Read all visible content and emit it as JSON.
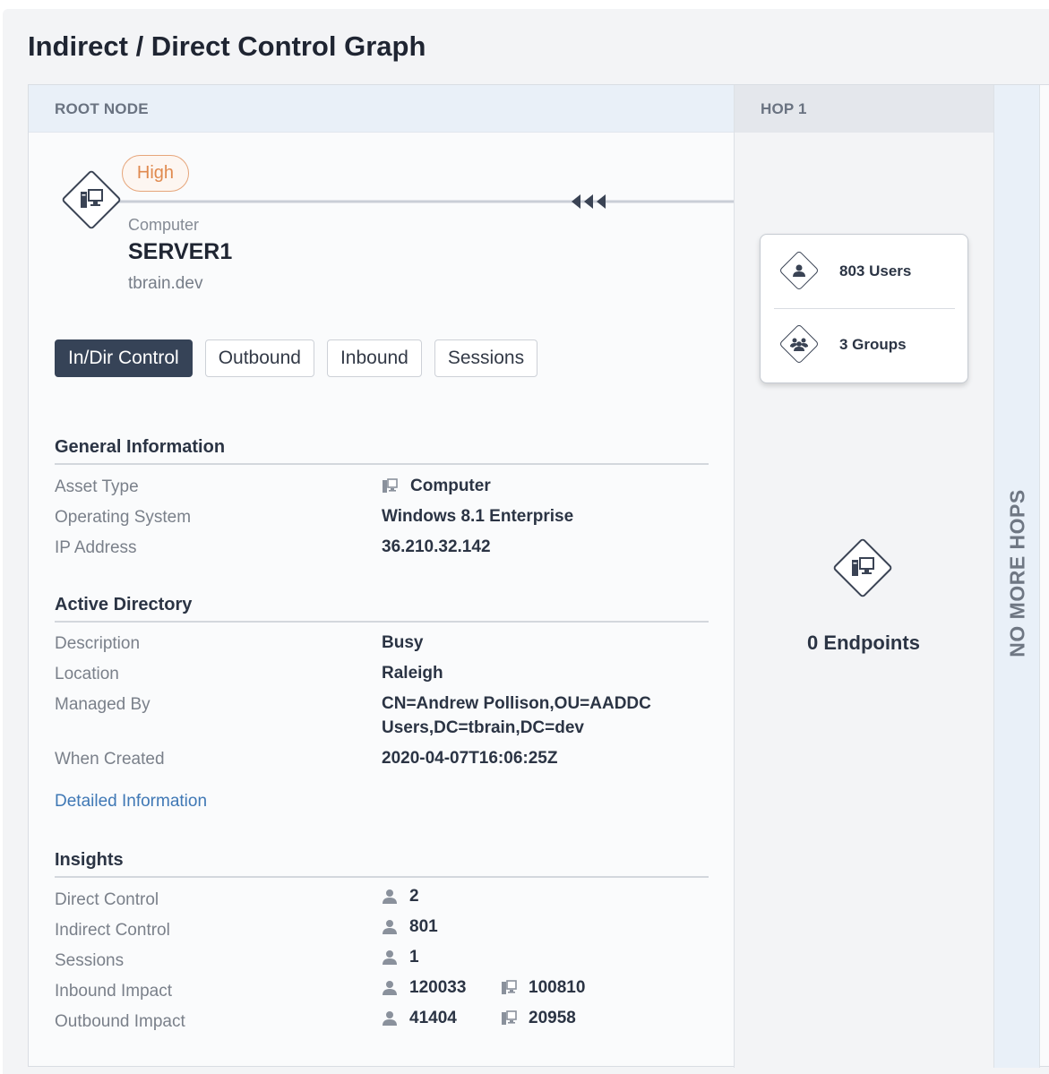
{
  "page": {
    "title": "Indirect / Direct Control Graph"
  },
  "columns": {
    "root_header": "ROOT NODE",
    "hop_header": "HOP 1",
    "no_more_hops": "NO MORE HOPS"
  },
  "node": {
    "risk_badge": "High",
    "type": "Computer",
    "name": "SERVER1",
    "domain": "tbrain.dev"
  },
  "tabs": [
    "In/Dir Control",
    "Outbound",
    "Inbound",
    "Sessions"
  ],
  "general": {
    "title": "General Information",
    "rows": [
      {
        "label": "Asset Type",
        "value": "Computer"
      },
      {
        "label": "Operating System",
        "value": "Windows 8.1 Enterprise"
      },
      {
        "label": "IP Address",
        "value": "36.210.32.142"
      }
    ]
  },
  "ad": {
    "title": "Active Directory",
    "rows": [
      {
        "label": "Description",
        "value": "Busy"
      },
      {
        "label": "Location",
        "value": "Raleigh"
      },
      {
        "label": "Managed By",
        "value_line1": "CN=Andrew Pollison,OU=AADDC",
        "value_line2": "Users,DC=tbrain,DC=dev"
      },
      {
        "label": "When Created",
        "value": "2020-04-07T16:06:25Z"
      }
    ],
    "link": "Detailed Information"
  },
  "insights": {
    "title": "Insights",
    "rows": [
      {
        "label": "Direct Control",
        "users": "2"
      },
      {
        "label": "Indirect Control",
        "users": "801"
      },
      {
        "label": "Sessions",
        "users": "1"
      },
      {
        "label": "Inbound Impact",
        "users": "120033",
        "computers": "100810"
      },
      {
        "label": "Outbound Impact",
        "users": "41404",
        "computers": "20958"
      }
    ]
  },
  "hop": {
    "users": "803 Users",
    "groups": "3 Groups",
    "endpoints": "0 Endpoints"
  },
  "icons": {
    "computer": "computer-icon",
    "user": "user-icon",
    "group": "group-icon",
    "arrows": "triple-arrow-left-icon"
  },
  "colors": {
    "accent_dark": "#364357",
    "risk_high": "#e08a4f",
    "link": "#3f78b5",
    "header_bg": "#e9f0f8"
  }
}
